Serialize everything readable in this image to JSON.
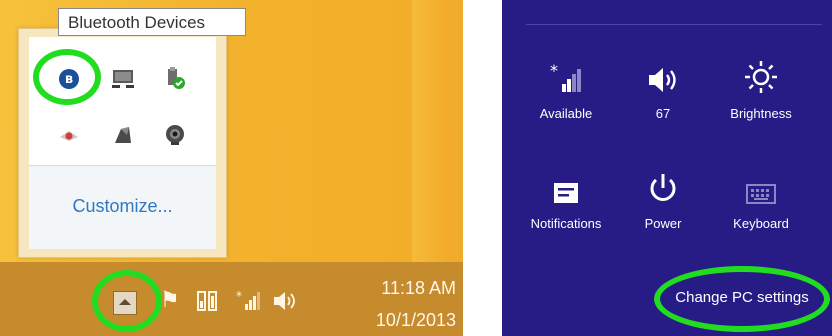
{
  "tray_overflow": {
    "tooltip": "Bluetooth Devices",
    "icons_row1": [
      "bluetooth-icon",
      "network-computer-icon",
      "usb-safe-remove-icon"
    ],
    "icons_row2": [
      "media-warning-icon",
      "audio-device-icon",
      "webcam-icon"
    ],
    "customize_label": "Customize..."
  },
  "taskbar": {
    "show_hidden_icons": "chevron-up-icon",
    "time": "11:18 AM",
    "date": "10/1/2013"
  },
  "quick_settings": {
    "network_label": "Available",
    "volume_label": "67",
    "brightness_label": "Brightness",
    "notifications_label": "Notifications",
    "power_label": "Power",
    "keyboard_label": "Keyboard",
    "change_pc_settings": "Change PC settings"
  },
  "colors": {
    "charm_background": "#271c86",
    "highlight_ring": "#22dd1f",
    "desktop": "#f3b12c",
    "link": "#3177c2"
  }
}
